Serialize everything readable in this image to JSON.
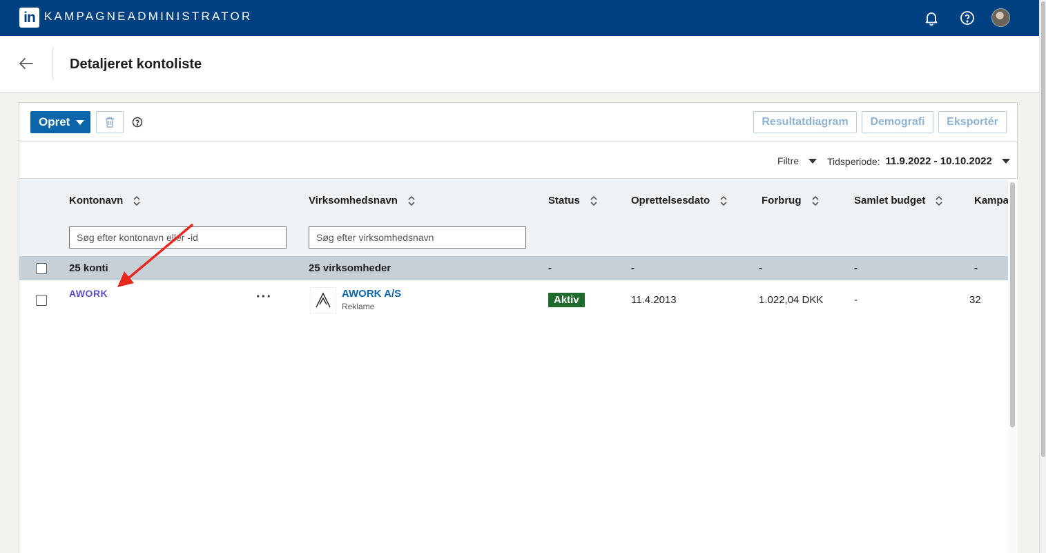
{
  "app": {
    "logo_text": "in",
    "title": "KAMPAGNEADMINISTRATOR"
  },
  "topbar_icons": [
    "bell-icon",
    "help-icon",
    "avatar"
  ],
  "header": {
    "title": "Detaljeret kontoliste"
  },
  "toolbar": {
    "create_label": "Opret",
    "results_chart_label": "Resultatdiagram",
    "demographics_label": "Demografi",
    "export_label": "Eksportér"
  },
  "filters": {
    "filter_label": "Filtre",
    "period_label": "Tidsperiode:",
    "period_value": "11.9.2022 - 10.10.2022"
  },
  "table": {
    "columns": [
      "Kontonavn",
      "Virksomhedsnavn",
      "Status",
      "Oprettelsesdato",
      "Forbrug",
      "Samlet budget",
      "Kampa"
    ],
    "search": {
      "account_placeholder": "Søg efter kontonavn eller -id",
      "company_placeholder": "Søg efter virksomhedsnavn"
    },
    "summary": {
      "accounts": "25 konti",
      "companies": "25 virksomheder",
      "status": "-",
      "created": "-",
      "spend": "-",
      "budget": "-",
      "campaigns": "-"
    },
    "rows": [
      {
        "account": "AWORK",
        "more": "···",
        "company": "AWORK A/S",
        "company_type": "Reklame",
        "status": "Aktiv",
        "created": "11.4.2013",
        "spend": "1.022,04 DKK",
        "budget": "-",
        "campaigns": "32"
      }
    ]
  },
  "colors": {
    "topbar": "#004182",
    "primary": "#0a66a8",
    "status_active": "#1f6b2e",
    "account_link": "#5a4fc7",
    "annotation_arrow": "#e8271f"
  }
}
